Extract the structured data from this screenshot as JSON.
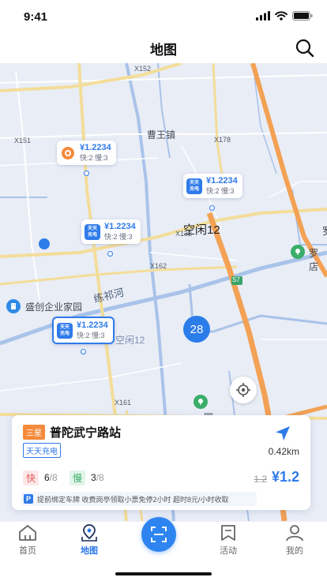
{
  "status_bar": {
    "time": "9:41"
  },
  "header": {
    "title": "地图"
  },
  "map": {
    "road_labels": [
      "X152",
      "X151",
      "X178",
      "X132",
      "X162",
      "X161",
      "S7"
    ],
    "place_labels": {
      "cao_wang": "曹王镇",
      "river": "练祁河",
      "shengchuang": "盛创企业家园",
      "luodian": "罗店",
      "idle_faded": "空闲12",
      "edge_char": "罗",
      "edge_fragment": "园"
    },
    "idle_label": "空闲12",
    "cluster_count": "28",
    "stations": [
      {
        "price": "¥1.2234",
        "fast": "快:2",
        "slow": "慢:3",
        "logo": "gear"
      },
      {
        "price": "¥1.2234",
        "fast": "快:2",
        "slow": "慢:3",
        "logo_line1": "天天",
        "logo_line2": "充电"
      },
      {
        "price": "¥1.2234",
        "fast": "快:2",
        "slow": "慢:3",
        "logo_line1": "天天",
        "logo_line2": "充电"
      },
      {
        "price": "¥1.2234",
        "fast": "快:2",
        "slow": "慢:3",
        "logo_line1": "天天",
        "logo_line2": "充电",
        "selected": true
      }
    ]
  },
  "card": {
    "rank_badge": "三星",
    "station_name": "普陀武宁路站",
    "brand": "天天充电",
    "distance": "0.42km",
    "fast_label": "快",
    "fast_available": "6",
    "fast_total": "/8",
    "slow_label": "慢",
    "slow_available": "3",
    "slow_total": "/8",
    "old_price": "1.2",
    "new_price": "¥1.2",
    "notice_icon": "P",
    "notice": "提前绑定车牌 收费岗亭领取小票免停2小时 超时8元/小时收取"
  },
  "tabbar": {
    "tabs": [
      {
        "label": "首页",
        "icon": "home-icon"
      },
      {
        "label": "地图",
        "icon": "map-pin-icon",
        "active": true
      },
      {
        "label": "活动",
        "icon": "bookmark-icon"
      },
      {
        "label": "我的",
        "icon": "user-icon"
      }
    ]
  },
  "colors": {
    "accent": "#2f7bea",
    "map_bg": "#e9edf6",
    "highway": "#f3a155",
    "road": "#f3dd99",
    "water": "#a9c3e9"
  }
}
